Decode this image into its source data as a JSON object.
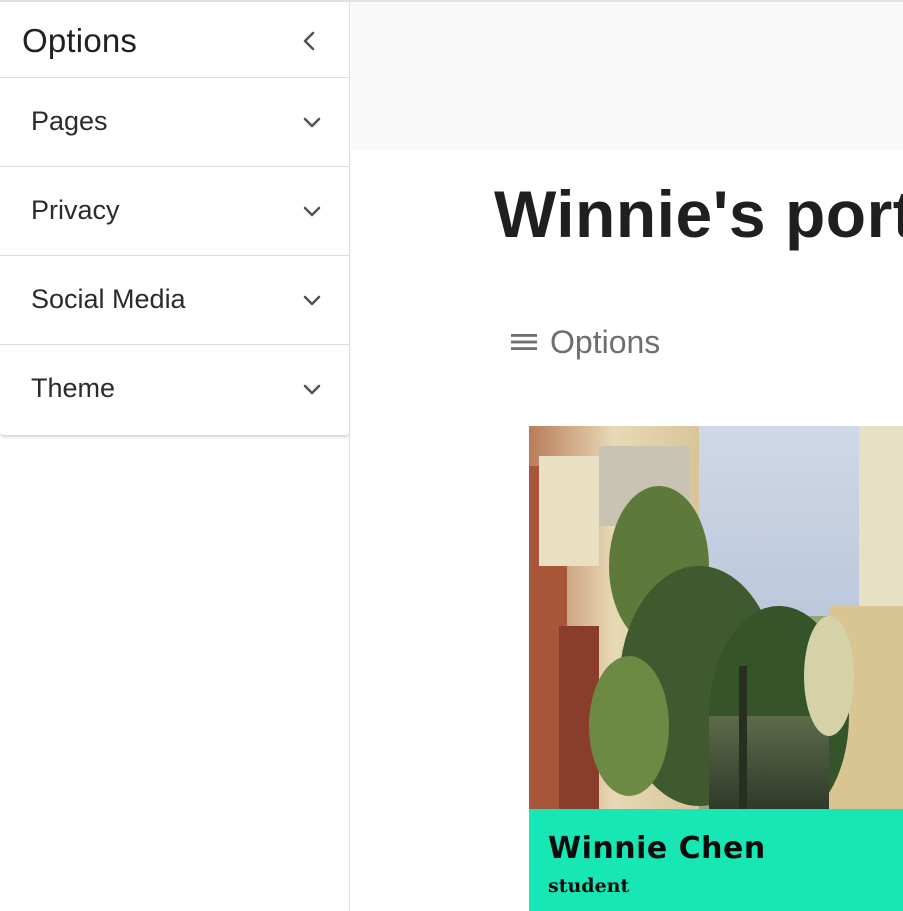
{
  "sidebar": {
    "title": "Options",
    "sections": [
      {
        "label": "Pages"
      },
      {
        "label": "Privacy"
      },
      {
        "label": "Social Media"
      },
      {
        "label": "Theme"
      }
    ]
  },
  "main": {
    "title": "Winnie's portf",
    "options_label": "Options"
  },
  "card": {
    "name": "Winnie Chen",
    "role": "student",
    "accent": "#17e6b5"
  },
  "icons": {
    "collapse": "chevron-left-icon",
    "expand": "chevron-down-icon",
    "menu": "hamburger-icon"
  }
}
